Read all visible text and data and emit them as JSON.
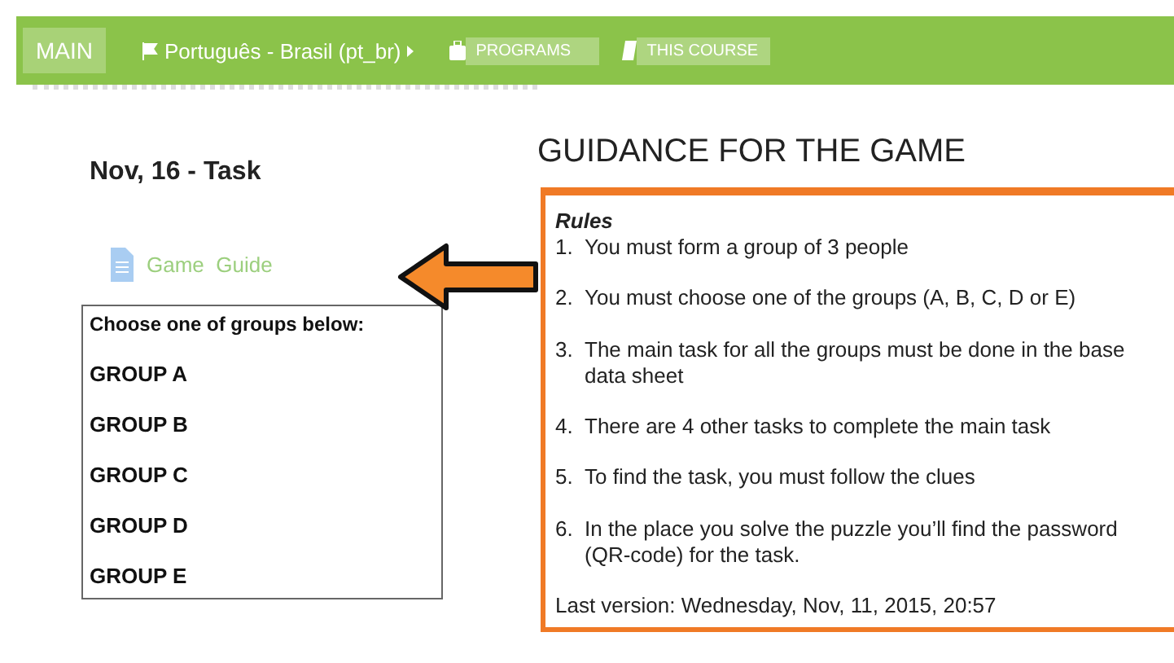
{
  "nav": {
    "items": [
      {
        "label": "MAIN",
        "kind": "home",
        "selected": true
      },
      {
        "label": "Português - Brasil (pt_br)",
        "kind": "language",
        "selected": false
      },
      {
        "label": "PROGRAMS",
        "kind": "programs",
        "selected": false
      },
      {
        "label": "THIS COURSE",
        "kind": "course",
        "selected": false
      }
    ]
  },
  "left": {
    "title": "Nov, 16 - Task",
    "resource": {
      "label": "Game  Guide"
    },
    "groups_box": {
      "heading": "Choose one of groups below:",
      "groups": [
        "GROUP A",
        "GROUP B",
        "GROUP C",
        "GROUP D",
        "GROUP E"
      ]
    }
  },
  "right": {
    "title": "GUIDANCE FOR THE GAME",
    "rules_heading": "Rules",
    "rules": [
      {
        "number": "1.",
        "text": "You must form a group of 3 people"
      },
      {
        "number": "2.",
        "text": "You must choose one of the groups (A, B, C, D or E)"
      },
      {
        "number": "3.",
        "text": "The main task for all the groups must be done in the base data sheet"
      },
      {
        "number": "4.",
        "text": "There are 4 other tasks to complete the main task"
      },
      {
        "number": "5.",
        "text": "To find the task, you must follow the clues"
      },
      {
        "number": "6.",
        "text": "In the place you solve the puzzle you’ll find the password (QR-code) for the task."
      }
    ],
    "last_version": "Last version: Wednesday, Nov, 11, 2015, 20:57"
  }
}
